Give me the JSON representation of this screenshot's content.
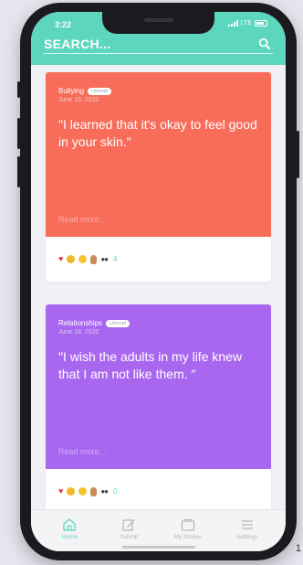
{
  "status_bar": {
    "time": "3:22",
    "network": "LTE"
  },
  "search": {
    "placeholder": "SEARCH..."
  },
  "stories": [
    {
      "category": "Bullying",
      "badge": "Unread",
      "date": "June 15, 2020",
      "quote": "\"I learned that it's okay to feel good in your skin.\"",
      "read_more": "Read more...",
      "reaction_count": "4",
      "color": "#f86c5a"
    },
    {
      "category": "Relationships",
      "badge": "Unread",
      "date": "June 18, 2020",
      "quote": "\"I wish the adults in my life knew that I am not like them. \"",
      "read_more": "Read more...",
      "reaction_count": "0",
      "color": "#a967f0"
    }
  ],
  "tabs": [
    {
      "label": "Home",
      "icon": "home-icon",
      "active": true
    },
    {
      "label": "Submit",
      "icon": "edit-icon",
      "active": false
    },
    {
      "label": "My Stories",
      "icon": "folder-icon",
      "active": false
    },
    {
      "label": "Settings",
      "icon": "menu-icon",
      "active": false
    }
  ],
  "page_number": "1",
  "colors": {
    "accent": "#5cd6bd",
    "tab_inactive": "#b6b6bb"
  }
}
